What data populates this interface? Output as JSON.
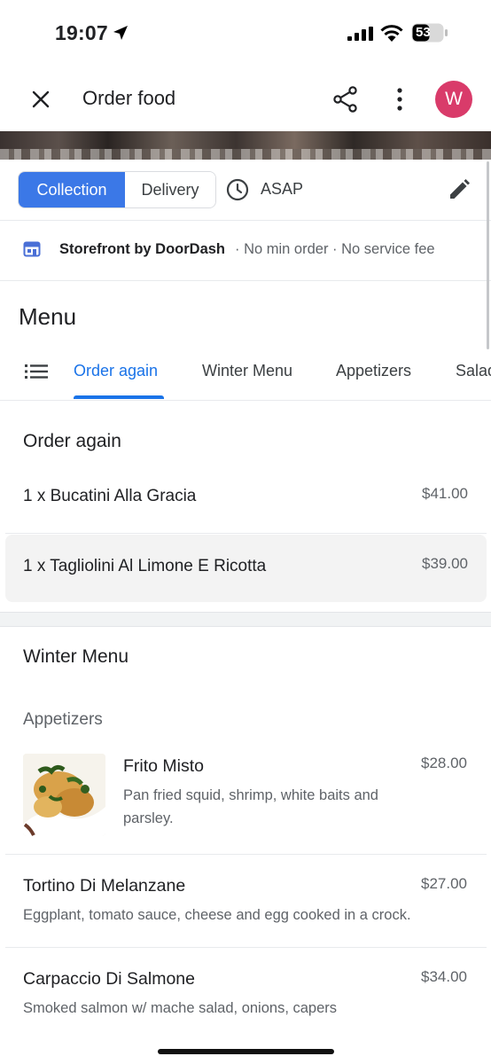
{
  "status": {
    "time": "19:07",
    "battery": "53"
  },
  "header": {
    "title": "Order food",
    "avatar_initial": "W"
  },
  "mode": {
    "collection": "Collection",
    "delivery": "Delivery",
    "time_label": "ASAP"
  },
  "store": {
    "name": "Storefront by DoorDash",
    "info": "· No min order · No service fee"
  },
  "menu": {
    "title": "Menu",
    "tabs": [
      "Order again",
      "Winter Menu",
      "Appetizers",
      "Salad"
    ]
  },
  "order_again": {
    "title": "Order again",
    "items": [
      {
        "name": "1 x Bucatini Alla Gracia",
        "price": "$41.00"
      },
      {
        "name": "1 x Tagliolini Al Limone E Ricotta",
        "price": "$39.00"
      }
    ]
  },
  "winter_menu": {
    "title": "Winter Menu",
    "subsection": "Appetizers",
    "items": [
      {
        "name": "Frito Misto",
        "desc1": "Pan fried squid, shrimp, white baits and",
        "desc2": "parsley.",
        "price": "$28.00"
      },
      {
        "name": "Tortino Di Melanzane",
        "desc": "Eggplant, tomato sauce, cheese and egg cooked in a crock.",
        "price": "$27.00"
      },
      {
        "name": "Carpaccio Di Salmone",
        "desc": "Smoked salmon w/ mache salad, onions, capers",
        "price": "$34.00"
      }
    ]
  },
  "colors": {
    "accent": "#1a73e8",
    "collection_active": "#3b78e7",
    "avatar": "#d93b6a"
  }
}
